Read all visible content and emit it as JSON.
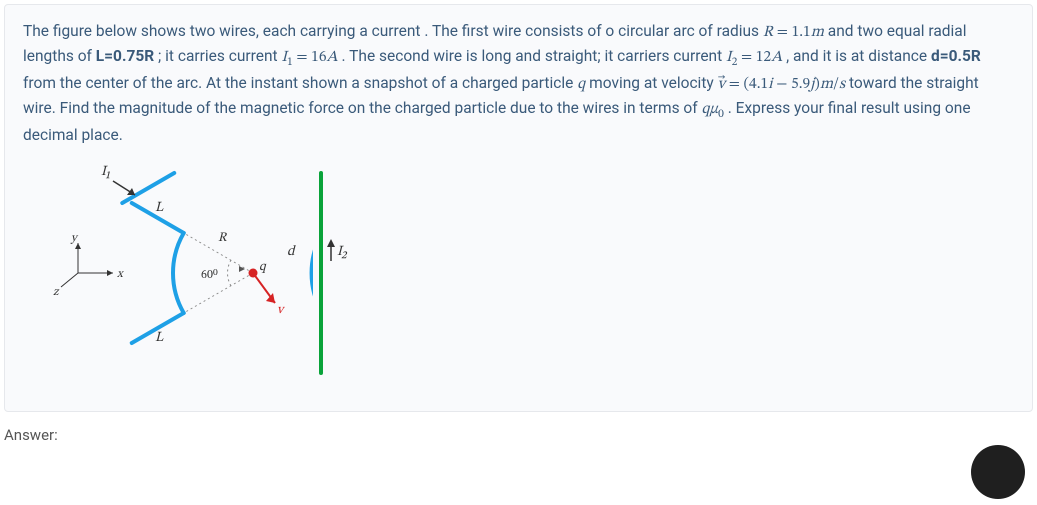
{
  "question": {
    "frag1": "The figure below shows two wires, each carrying a current . The first wire consists of o circular arc of radius ",
    "radius_eq": "R = 1.1m",
    "frag2": " and two equal radial lengths of ",
    "L_eq": "L=0.75R",
    "frag3": "; it carries current ",
    "I1_eq": "I₁ = 16A",
    "frag4": ". The second wire is long and straight; it carriers current ",
    "I2_eq": "I₂ = 12A",
    "frag5": ", and it is at distance ",
    "d_eq": "d=0.5R",
    "frag6": " from the center of the arc. At the instant shown a snapshot of a charged particle ",
    "qvar": "q",
    "frag7": " moving at velocity ",
    "v_eq": "v⃗ = (4.1i − 5.9j)m/s",
    "frag8": " toward the straight wire. Find the magnitude of the magnetic force on the charged particle due to the wires in terms of ",
    "qmu0": "qμ₀",
    "frag9": ". Express your final result using one decimal place."
  },
  "figure": {
    "I1": "I₁",
    "L_top": "L",
    "L_bot": "L",
    "R": "R",
    "angle": "60⁰",
    "q": "q",
    "v": "v",
    "d": "d",
    "I2": "I₂",
    "axis_x": "x",
    "axis_y": "y",
    "axis_z": "z"
  },
  "answer_label": "Answer:",
  "chart_data": {
    "type": "diagram",
    "R_m": 1.1,
    "L_relation": "0.75R",
    "d_relation": "0.5R",
    "I1_A": 16,
    "I2_A": 12,
    "arc_angle_deg": 60,
    "velocity": {
      "vx": 4.1,
      "vy": -5.9,
      "units": "m/s"
    }
  }
}
